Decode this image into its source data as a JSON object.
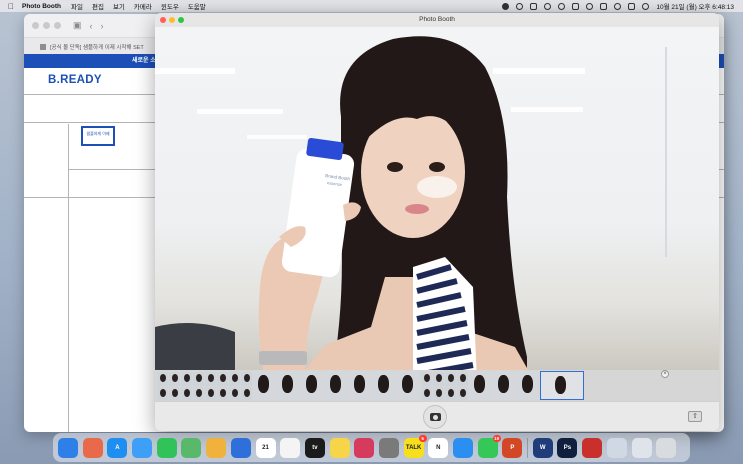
{
  "menubar": {
    "app_name": "Photo Booth",
    "items": [
      "파일",
      "편집",
      "보기",
      "카메라",
      "윈도우",
      "도움말"
    ],
    "clock": "10월 21일 (월) 오후 6:48:13"
  },
  "browser": {
    "tab_title": "[공식 몰 단독] 샘플하게 이제 시작해 SET",
    "banner_text": "새로운 소",
    "logo": "B.READY",
    "thumb_text": "샘플하게 이제",
    "side_letter": "점"
  },
  "photobooth": {
    "title": "Photo Booth",
    "bottle_text_1": "Brand Booth",
    "bottle_text_2": "essence",
    "share_icon": "share-icon",
    "shutter_icon": "camera-icon"
  },
  "dock": {
    "items": [
      {
        "name": "finder-icon",
        "color": "#2f7fe8",
        "label": ""
      },
      {
        "name": "launchpad-icon",
        "color": "#e86a4a",
        "label": ""
      },
      {
        "name": "app-store-icon",
        "color": "#1e8ef0",
        "label": "A"
      },
      {
        "name": "mail-icon",
        "color": "#3d9ff5",
        "label": ""
      },
      {
        "name": "facetime-icon",
        "color": "#32c25a",
        "label": ""
      },
      {
        "name": "maps-icon",
        "color": "#59b86a",
        "label": ""
      },
      {
        "name": "photos-icon",
        "color": "#f0b23c",
        "label": ""
      },
      {
        "name": "keynote-icon",
        "color": "#2e6fd9",
        "label": ""
      },
      {
        "name": "calendar-icon",
        "color": "#ffffff",
        "label": "21"
      },
      {
        "name": "reminders-icon",
        "color": "#f4f4f4",
        "label": ""
      },
      {
        "name": "apple-tv-icon",
        "color": "#1b1b1b",
        "label": "tv"
      },
      {
        "name": "notes-icon",
        "color": "#f7d54a",
        "label": ""
      },
      {
        "name": "preview-icon",
        "color": "#d63a5c",
        "label": ""
      },
      {
        "name": "system-settings-icon",
        "color": "#7a7a7a",
        "label": ""
      },
      {
        "name": "kakaotalk-icon",
        "color": "#f7df1e",
        "label": "TALK",
        "badge": "5"
      },
      {
        "name": "notion-icon",
        "color": "#ffffff",
        "label": "N"
      },
      {
        "name": "safari-icon",
        "color": "#2a8ff0",
        "label": ""
      },
      {
        "name": "messages-icon",
        "color": "#36c759",
        "label": "",
        "badge": "19"
      },
      {
        "name": "powerpoint-icon",
        "color": "#d24726",
        "label": "P"
      },
      {
        "name": "separator",
        "color": "",
        "label": ""
      },
      {
        "name": "webex-icon",
        "color": "#1f3d7a",
        "label": "W"
      },
      {
        "name": "photoshop-icon",
        "color": "#0f1f3d",
        "label": "Ps"
      },
      {
        "name": "photo-booth-icon",
        "color": "#c9302c",
        "label": ""
      },
      {
        "name": "finder-window-icon",
        "color": "#cfd8e3",
        "label": ""
      },
      {
        "name": "downloads-icon",
        "color": "#dfe3ea",
        "label": ""
      },
      {
        "name": "trash-icon",
        "color": "#d8dbe0",
        "label": ""
      }
    ]
  }
}
